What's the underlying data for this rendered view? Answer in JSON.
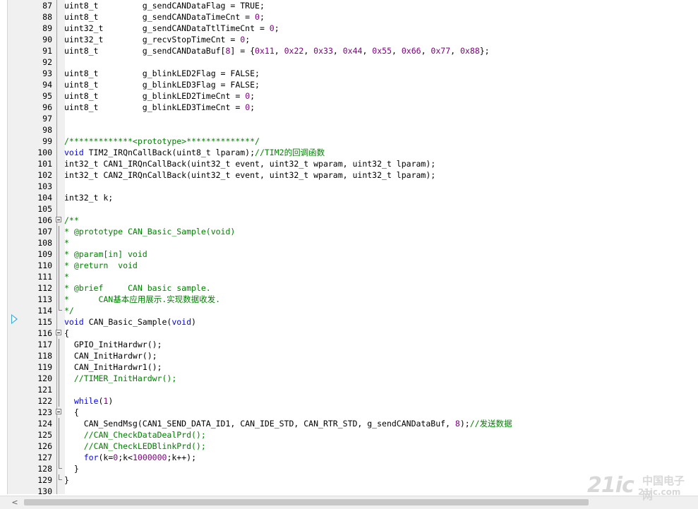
{
  "editor": {
    "lines": [
      {
        "num": "87",
        "code": "uint8_t         g_sendCANDataFlag = TRUE;"
      },
      {
        "num": "88",
        "code": "uint8_t         g_sendCANDataTimeCnt = 0;"
      },
      {
        "num": "89",
        "code": "uint32_t        g_sendCANDataTtlTimeCnt = 0;"
      },
      {
        "num": "90",
        "code": "uint32_t        g_recvStopTimeCnt = 0;"
      },
      {
        "num": "91",
        "code": "uint8_t         g_sendCANDataBuf[8] = {0x11, 0x22, 0x33, 0x44, 0x55, 0x66, 0x77, 0x88};"
      },
      {
        "num": "92",
        "code": ""
      },
      {
        "num": "93",
        "code": "uint8_t         g_blinkLED2Flag = FALSE;"
      },
      {
        "num": "94",
        "code": "uint8_t         g_blinkLED3Flag = FALSE;"
      },
      {
        "num": "95",
        "code": "uint8_t         g_blinkLED2TimeCnt = 0;"
      },
      {
        "num": "96",
        "code": "uint8_t         g_blinkLED3TimeCnt = 0;"
      },
      {
        "num": "97",
        "code": ""
      },
      {
        "num": "98",
        "code": ""
      },
      {
        "num": "99",
        "code": "/*************<prototype>**************/"
      },
      {
        "num": "100",
        "code": "void TIM2_IRQnCallBack(uint8_t lparam);//TIM2的回调函数"
      },
      {
        "num": "101",
        "code": "int32_t CAN1_IRQnCallBack(uint32_t event, uint32_t wparam, uint32_t lparam);"
      },
      {
        "num": "102",
        "code": "int32_t CAN2_IRQnCallBack(uint32_t event, uint32_t wparam, uint32_t lparam);"
      },
      {
        "num": "103",
        "code": ""
      },
      {
        "num": "104",
        "code": "int32_t k;"
      },
      {
        "num": "105",
        "code": ""
      },
      {
        "num": "106",
        "code": "/**"
      },
      {
        "num": "107",
        "code": "* @prototype CAN_Basic_Sample(void)"
      },
      {
        "num": "108",
        "code": "*"
      },
      {
        "num": "109",
        "code": "* @param[in] void"
      },
      {
        "num": "110",
        "code": "* @return  void"
      },
      {
        "num": "111",
        "code": "*"
      },
      {
        "num": "112",
        "code": "* @brief     CAN basic sample."
      },
      {
        "num": "113",
        "code": "*      CAN基本应用展示.实现数据收发."
      },
      {
        "num": "114",
        "code": "*/"
      },
      {
        "num": "115",
        "code": "void CAN_Basic_Sample(void)"
      },
      {
        "num": "116",
        "code": "{"
      },
      {
        "num": "117",
        "code": "  GPIO_InitHardwr();"
      },
      {
        "num": "118",
        "code": "  CAN_InitHardwr();"
      },
      {
        "num": "119",
        "code": "  CAN_InitHardwr1();"
      },
      {
        "num": "120",
        "code": "  //TIMER_InitHardwr();"
      },
      {
        "num": "121",
        "code": ""
      },
      {
        "num": "122",
        "code": "  while(1)"
      },
      {
        "num": "123",
        "code": "  {"
      },
      {
        "num": "124",
        "code": "    CAN_SendMsg(CAN1_SEND_DATA_ID1, CAN_IDE_STD, CAN_RTR_STD, g_sendCANDataBuf, 8);//发送数据"
      },
      {
        "num": "125",
        "code": "    //CAN_CheckDataDealPrd();"
      },
      {
        "num": "126",
        "code": "    //CAN_CheckLEDBlinkPrd();"
      },
      {
        "num": "127",
        "code": "    for(k=0;k<1000000;k++);"
      },
      {
        "num": "128",
        "code": "  }"
      },
      {
        "num": "129",
        "code": "}"
      },
      {
        "num": "130",
        "code": ""
      }
    ]
  },
  "scrollbar": {
    "left_arrow_icon": "chevron-left-icon",
    "left_arrow_glyph": "<"
  },
  "watermark": {
    "logo": "21ic",
    "cn_text": "中国电子网",
    "url": "21ic.com"
  },
  "colors": {
    "keyword": "#0000ff",
    "comment": "#008000",
    "number": "#800080",
    "marker": "#3ba9d4"
  }
}
